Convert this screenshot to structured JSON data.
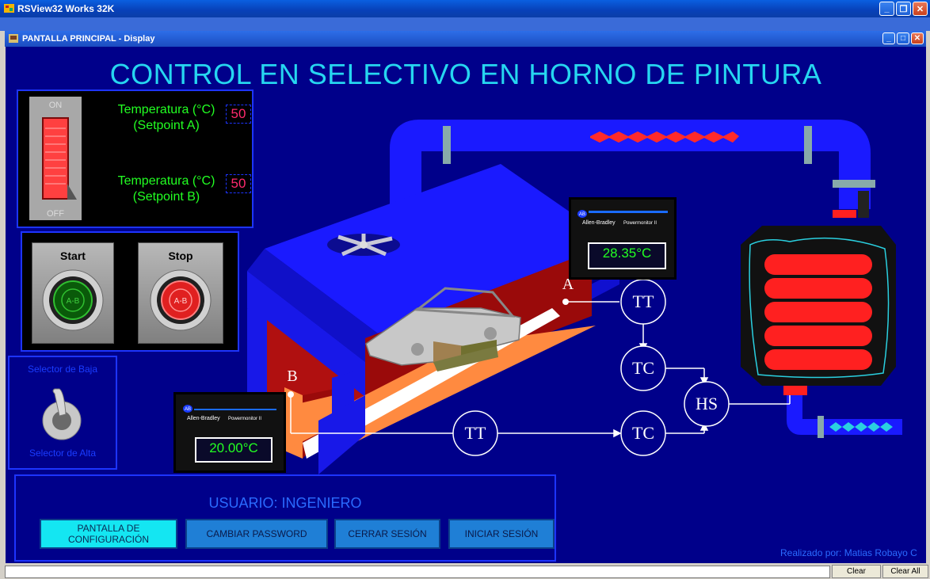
{
  "window": {
    "title": "RSView32 Works 32K",
    "child_title": "PANTALLA PRINCIPAL - Display"
  },
  "display": {
    "title": "CONTROL EN SELECTIVO EN HORNO DE PINTURA",
    "switch": {
      "on_label": "ON",
      "off_label": "OFF"
    },
    "setpoint_a": {
      "label_line1": "Temperatura (°C)",
      "label_line2": "(Setpoint A)",
      "value": "50"
    },
    "setpoint_b": {
      "label_line1": "Temperatura (°C)",
      "label_line2": "(Setpoint B)",
      "value": "50"
    },
    "start_label": "Start",
    "stop_label": "Stop",
    "button_marking": "A-B",
    "selector": {
      "top_label": "Selector de Baja",
      "bottom_label": "Selector de Alta"
    },
    "monitor_a": {
      "brand": "Allen-Bradley",
      "model": "Powermonitor II",
      "value": "28.35°C"
    },
    "monitor_b": {
      "brand": "Allen-Bradley",
      "model": "Powermonitor II",
      "value": "20.00°C"
    },
    "points": {
      "a": "A",
      "b": "B"
    },
    "instruments": {
      "tt": "TT",
      "tc": "TC",
      "hs": "HS"
    },
    "user_label": "USUARIO: INGENIERO",
    "buttons": {
      "config_line1": "PANTALLA DE",
      "config_line2": "CONFIGURACIÓN",
      "password": "CAMBIAR PASSWORD",
      "logout": "CERRAR SESIÓN",
      "login": "INICIAR SESIÓN"
    },
    "credit": "Realizado por: Matias Robayo C"
  },
  "statusbar": {
    "clear": "Clear",
    "clear_all": "Clear All"
  },
  "colors": {
    "background": "#00008a",
    "title": "#26d6f0",
    "green": "#22ff22",
    "setpoint": "#ff2a6d",
    "pipe": "#1a1aff",
    "heater": "#ff2020"
  }
}
